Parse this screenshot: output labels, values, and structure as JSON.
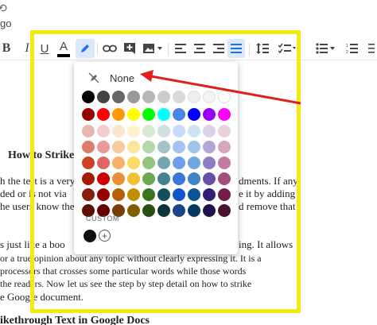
{
  "topbar": {
    "history_icon": "history-icon",
    "go_text": "go"
  },
  "toolbar": {
    "bold": "B",
    "italic": "I",
    "underline": "U",
    "text_color": "A",
    "highlight_icon": "pencil-icon",
    "link_icon": "link-icon",
    "comment_icon": "add-comment-icon",
    "image_icon": "image-icon",
    "align_left": "align-left-icon",
    "align_center": "align-center-icon",
    "align_right": "align-right-icon",
    "align_justify": "align-justify-icon",
    "line_spacing": "line-spacing-icon",
    "checklist": "checklist-icon",
    "bullets": "bulleted-list-icon",
    "numbers": "numbered-list-icon"
  },
  "highlight_menu": {
    "none_label": "None",
    "custom_label": "CUSTOM",
    "custom_color": "#111111",
    "rows": [
      [
        "#000000",
        "#434343",
        "#666666",
        "#999999",
        "#b7b7b7",
        "#cccccc",
        "#d9d9d9",
        "#efefef",
        "#f3f3f3",
        "#ffffff"
      ],
      [
        "#980000",
        "#ff0000",
        "#ff9900",
        "#ffff00",
        "#00ff00",
        "#00ffff",
        "#4a86e8",
        "#0000ff",
        "#9900ff",
        "#ff00ff"
      ],
      [
        "#e6b8af",
        "#f4cccc",
        "#fce5cd",
        "#fff2cc",
        "#d9ead3",
        "#d0e0e3",
        "#c9daf8",
        "#cfe2f3",
        "#d9d2e9",
        "#ead1dc"
      ],
      [
        "#dd7e6b",
        "#ea9999",
        "#f9cb9c",
        "#ffe599",
        "#b6d7a8",
        "#a2c4c9",
        "#a4c2f4",
        "#9fc5e8",
        "#b4a7d6",
        "#d5a6bd"
      ],
      [
        "#cc4125",
        "#e06666",
        "#f6b26b",
        "#ffd966",
        "#93c47d",
        "#76a5af",
        "#6d9eeb",
        "#6fa8dc",
        "#8e7cc3",
        "#c27ba0"
      ],
      [
        "#a61c00",
        "#cc0000",
        "#e69138",
        "#f1c232",
        "#6aa84f",
        "#45818e",
        "#3c78d8",
        "#3d85c6",
        "#674ea7",
        "#a64d79"
      ],
      [
        "#85200c",
        "#990000",
        "#b45f06",
        "#bf9000",
        "#38761d",
        "#134f5c",
        "#1155cc",
        "#0b5394",
        "#351c75",
        "#741b47"
      ],
      [
        "#5b0f00",
        "#660000",
        "#783f04",
        "#7f6000",
        "#274e13",
        "#0c343d",
        "#1c4587",
        "#073763",
        "#20124d",
        "#4c1130"
      ]
    ]
  },
  "document": {
    "heading1": "How to Strike",
    "lines": [
      "h the test is a very",
      "ded or is not via",
      "he users know the",
      "s just like a boo",
      "or a true opinion about any topic without clearly expressing it. It is a",
      "processors that crosses some particular words while those words",
      "the readers. Now let us see the step by step detail on how to strike",
      "e Google document."
    ],
    "right_fragments": [
      "dments. If any",
      "e it by adding",
      "d remove that",
      "ing. It allows"
    ],
    "heading2": "ikethrough Text in Google Docs"
  },
  "annotation": {
    "frame_color": "#f5e90f",
    "arrow_color": "#e0201b"
  }
}
